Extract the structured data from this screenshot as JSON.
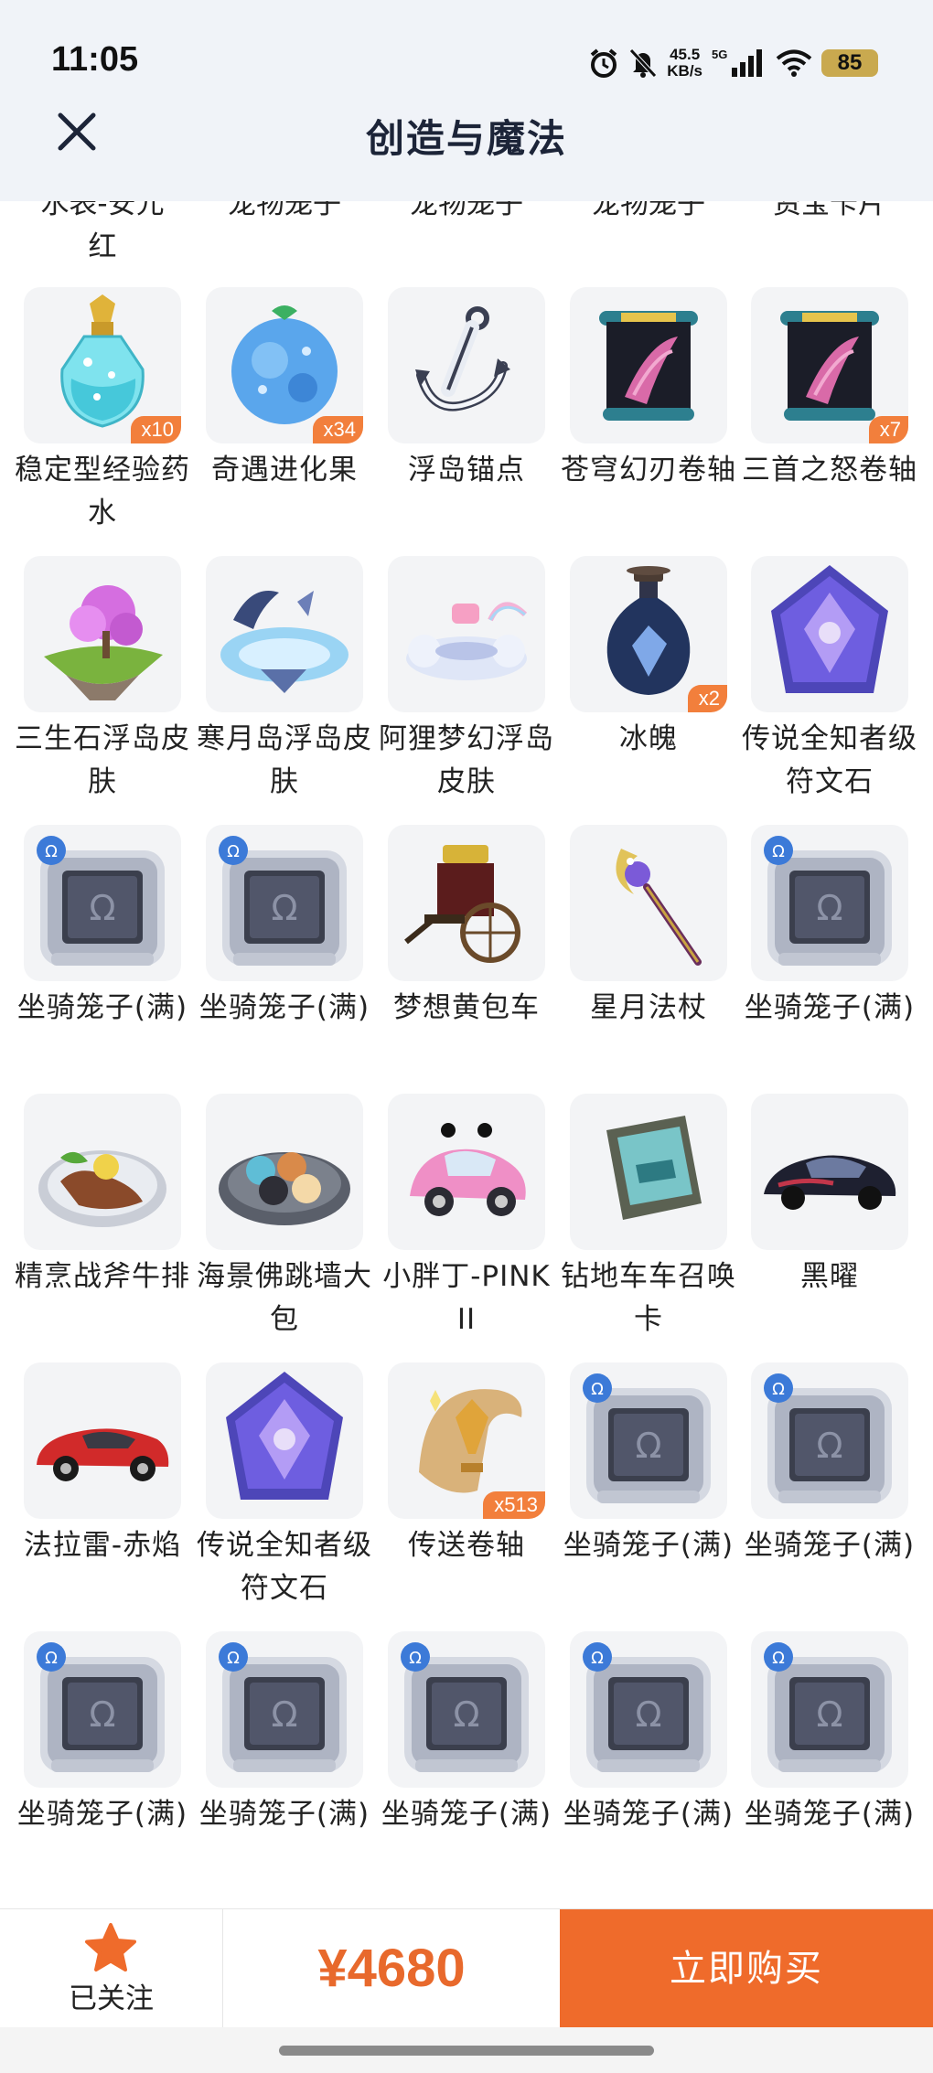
{
  "status_bar": {
    "time": "11:05",
    "net_speed_value": "45.5",
    "net_speed_unit": "KB/s",
    "network": "5G",
    "battery": "85"
  },
  "header": {
    "title": "创造与魔法",
    "close_icon": "close-icon"
  },
  "partial_row": [
    "水表-安元\n红",
    "宠物笼子",
    "宠物笼子",
    "宠物笼子",
    "资宝卡片"
  ],
  "items": [
    {
      "name": "稳定型经验药水",
      "qty": "x10",
      "icon": "potion-icon"
    },
    {
      "name": "奇遇进化果",
      "qty": "x34",
      "icon": "fruit-icon"
    },
    {
      "name": "浮岛锚点",
      "qty": "",
      "icon": "anchor-icon"
    },
    {
      "name": "苍穹幻刃卷轴",
      "qty": "",
      "icon": "scroll-icon"
    },
    {
      "name": "三首之怒卷轴",
      "qty": "x7",
      "icon": "scroll-icon"
    },
    {
      "name": "三生石浮岛皮肤",
      "qty": "",
      "icon": "island-pink-icon"
    },
    {
      "name": "寒月岛浮岛皮肤",
      "qty": "",
      "icon": "island-ice-icon"
    },
    {
      "name": "阿狸梦幻浮岛皮肤",
      "qty": "",
      "icon": "island-cloud-icon"
    },
    {
      "name": "冰魄",
      "qty": "x2",
      "icon": "bottle-icon"
    },
    {
      "name": "传说全知者级符文石",
      "qty": "",
      "icon": "rune-stone-icon"
    },
    {
      "name": "坐骑笼子(满)",
      "qty": "",
      "icon": "mount-cage-icon"
    },
    {
      "name": "坐骑笼子(满)",
      "qty": "",
      "icon": "mount-cage-icon"
    },
    {
      "name": "梦想黄包车",
      "qty": "",
      "icon": "rickshaw-icon"
    },
    {
      "name": "星月法杖",
      "qty": "",
      "icon": "staff-icon"
    },
    {
      "name": "坐骑笼子(满)",
      "qty": "",
      "icon": "mount-cage-icon"
    },
    {
      "name": "精烹战斧牛排",
      "qty": "",
      "icon": "steak-icon"
    },
    {
      "name": "海景佛跳墙大包",
      "qty": "",
      "icon": "buns-icon"
    },
    {
      "name": "小胖丁-PINK II",
      "qty": "",
      "icon": "pink-car-icon"
    },
    {
      "name": "钻地车车召唤卡",
      "qty": "",
      "icon": "card-icon"
    },
    {
      "name": "黑曜",
      "qty": "",
      "icon": "black-car-icon"
    },
    {
      "name": "法拉雷-赤焰",
      "qty": "",
      "icon": "red-car-icon"
    },
    {
      "name": "传说全知者级符文石",
      "qty": "",
      "icon": "rune-stone-icon"
    },
    {
      "name": "传送卷轴",
      "qty": "x513",
      "icon": "teleport-scroll-icon"
    },
    {
      "name": "坐骑笼子(满)",
      "qty": "",
      "icon": "mount-cage-icon"
    },
    {
      "name": "坐骑笼子(满)",
      "qty": "",
      "icon": "mount-cage-icon"
    },
    {
      "name": "坐骑笼子(满)",
      "qty": "",
      "icon": "mount-cage-icon"
    },
    {
      "name": "坐骑笼子(满)",
      "qty": "",
      "icon": "mount-cage-icon"
    },
    {
      "name": "坐骑笼子(满)",
      "qty": "",
      "icon": "mount-cage-icon"
    },
    {
      "name": "坐骑笼子(满)",
      "qty": "",
      "icon": "mount-cage-icon"
    },
    {
      "name": "坐骑笼子(满)",
      "qty": "",
      "icon": "mount-cage-icon"
    }
  ],
  "bottom_bar": {
    "follow_label": "已关注",
    "follow_icon": "star-icon",
    "price": "¥4680",
    "buy_label": "立即购买"
  },
  "colors": {
    "accent": "#ef6b2b",
    "price": "#e8692c",
    "qty_badge": "#f27f3c",
    "header_bg": "#f0f3f8",
    "tile_bg": "#f3f4f6"
  }
}
